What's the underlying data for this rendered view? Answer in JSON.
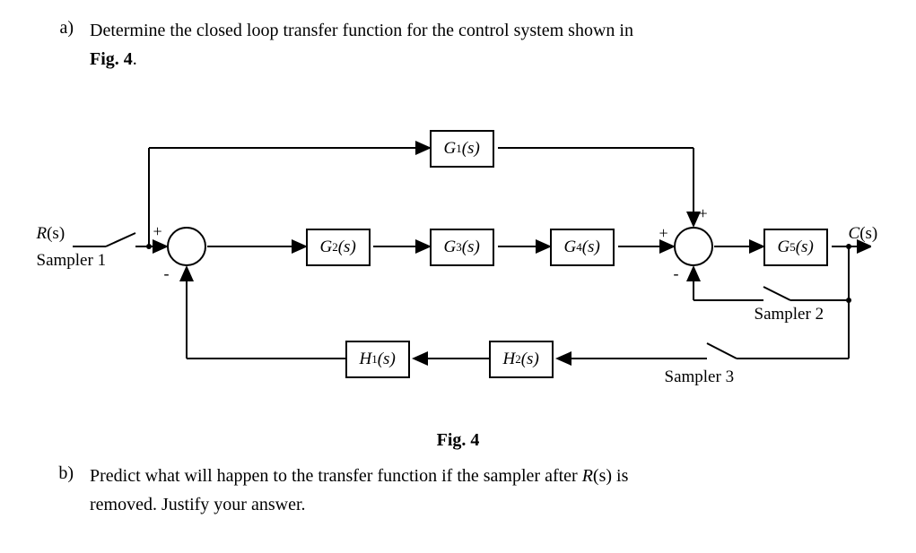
{
  "question_a": {
    "letter": "a)",
    "text1": "Determine the closed loop transfer function for the control system shown in",
    "text2_bold": "Fig. 4",
    "text2_after": "."
  },
  "question_b": {
    "letter": "b)",
    "text1": "Predict what will happen to the transfer function if the sampler after ",
    "text1_italic": "R",
    "text1_after": "(s) is",
    "text2": "removed. Justify your answer."
  },
  "fig_caption": "Fig. 4",
  "labels": {
    "R": "R",
    "s": "(s)",
    "C": "C",
    "sampler1": "Sampler 1",
    "sampler2": "Sampler 2",
    "sampler3": "Sampler 3",
    "G1": "G",
    "G1sub": "1",
    "G2": "G",
    "G2sub": "2",
    "G3": "G",
    "G3sub": "3",
    "G4": "G",
    "G4sub": "4",
    "G5": "G",
    "G5sub": "5",
    "H1": "H",
    "H1sub": "1",
    "H2": "H",
    "H2sub": "2",
    "plus": "+",
    "minus": "-"
  }
}
